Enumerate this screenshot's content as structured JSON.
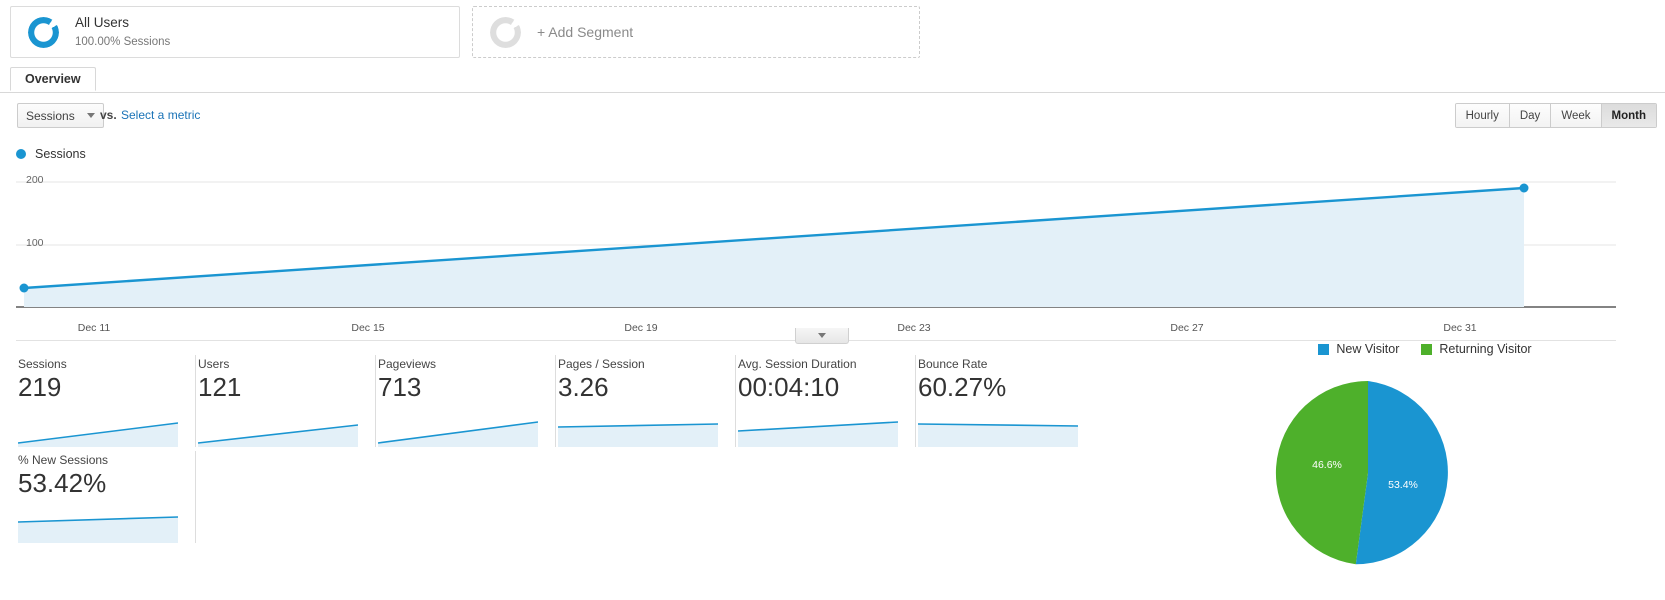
{
  "segment": {
    "all_users": {
      "title": "All Users",
      "subtitle": "100.00% Sessions",
      "icon": "donut-icon"
    },
    "add_segment_label": "+ Add Segment",
    "add_segment_icon": "donut-empty-icon"
  },
  "tabs": [
    {
      "label": "Overview",
      "active": true
    }
  ],
  "controls": {
    "metric_select_value": "Sessions",
    "vs_label": "vs.",
    "select_metric_label": "Select a metric",
    "caret_icon": "chevron-down-icon",
    "ranges": [
      {
        "label": "Hourly",
        "active": false
      },
      {
        "label": "Day",
        "active": false
      },
      {
        "label": "Week",
        "active": false
      },
      {
        "label": "Month",
        "active": true
      }
    ]
  },
  "chart_legend": {
    "label": "Sessions",
    "color": "#1a95d1"
  },
  "collapse_icon": "chevron-down-icon",
  "metrics": [
    {
      "label": "Sessions",
      "value": "219"
    },
    {
      "label": "Users",
      "value": "121"
    },
    {
      "label": "Pageviews",
      "value": "713"
    },
    {
      "label": "Pages / Session",
      "value": "3.26"
    },
    {
      "label": "Avg. Session Duration",
      "value": "00:04:10"
    },
    {
      "label": "Bounce Rate",
      "value": "60.27%"
    },
    {
      "label": "% New Sessions",
      "value": "53.42%"
    }
  ],
  "colors": {
    "accent": "#1a95d1",
    "area_fill": "#e3f0f8",
    "green": "#4eb02b",
    "link": "#1a73b7"
  },
  "chart_data": [
    {
      "type": "area",
      "title": "Sessions",
      "xlabel": "",
      "ylabel": "Sessions",
      "ylim": [
        0,
        220
      ],
      "yticks": [
        100,
        200
      ],
      "grid": true,
      "legend": "top-left",
      "x": [
        "Dec 11",
        "Dec 15",
        "Dec 19",
        "Dec 23",
        "Dec 27",
        "Dec 31"
      ],
      "xticks": [
        "Dec 11",
        "Dec 15",
        "Dec 19",
        "Dec 23",
        "Dec 27",
        "Dec 31"
      ],
      "series": [
        {
          "name": "Sessions",
          "color": "#1a95d1",
          "values": [
            30,
            62,
            94,
            126,
            158,
            190
          ]
        }
      ],
      "markers": [
        {
          "x": "Dec 11",
          "y": 30
        },
        {
          "x": "Dec 31",
          "y": 190
        }
      ]
    },
    {
      "type": "pie",
      "title": "",
      "legend": "top",
      "labels": [
        "New Visitor",
        "Returning Visitor"
      ],
      "values": [
        53.4,
        46.6
      ],
      "value_labels": [
        "53.4%",
        "46.6%"
      ],
      "colors": [
        "#1a95d1",
        "#4eb02b"
      ],
      "start_angle_deg": 0
    },
    {
      "type": "line",
      "title": "Sessions sparkline",
      "values": [
        30,
        190
      ],
      "color": "#1a95d1"
    }
  ]
}
